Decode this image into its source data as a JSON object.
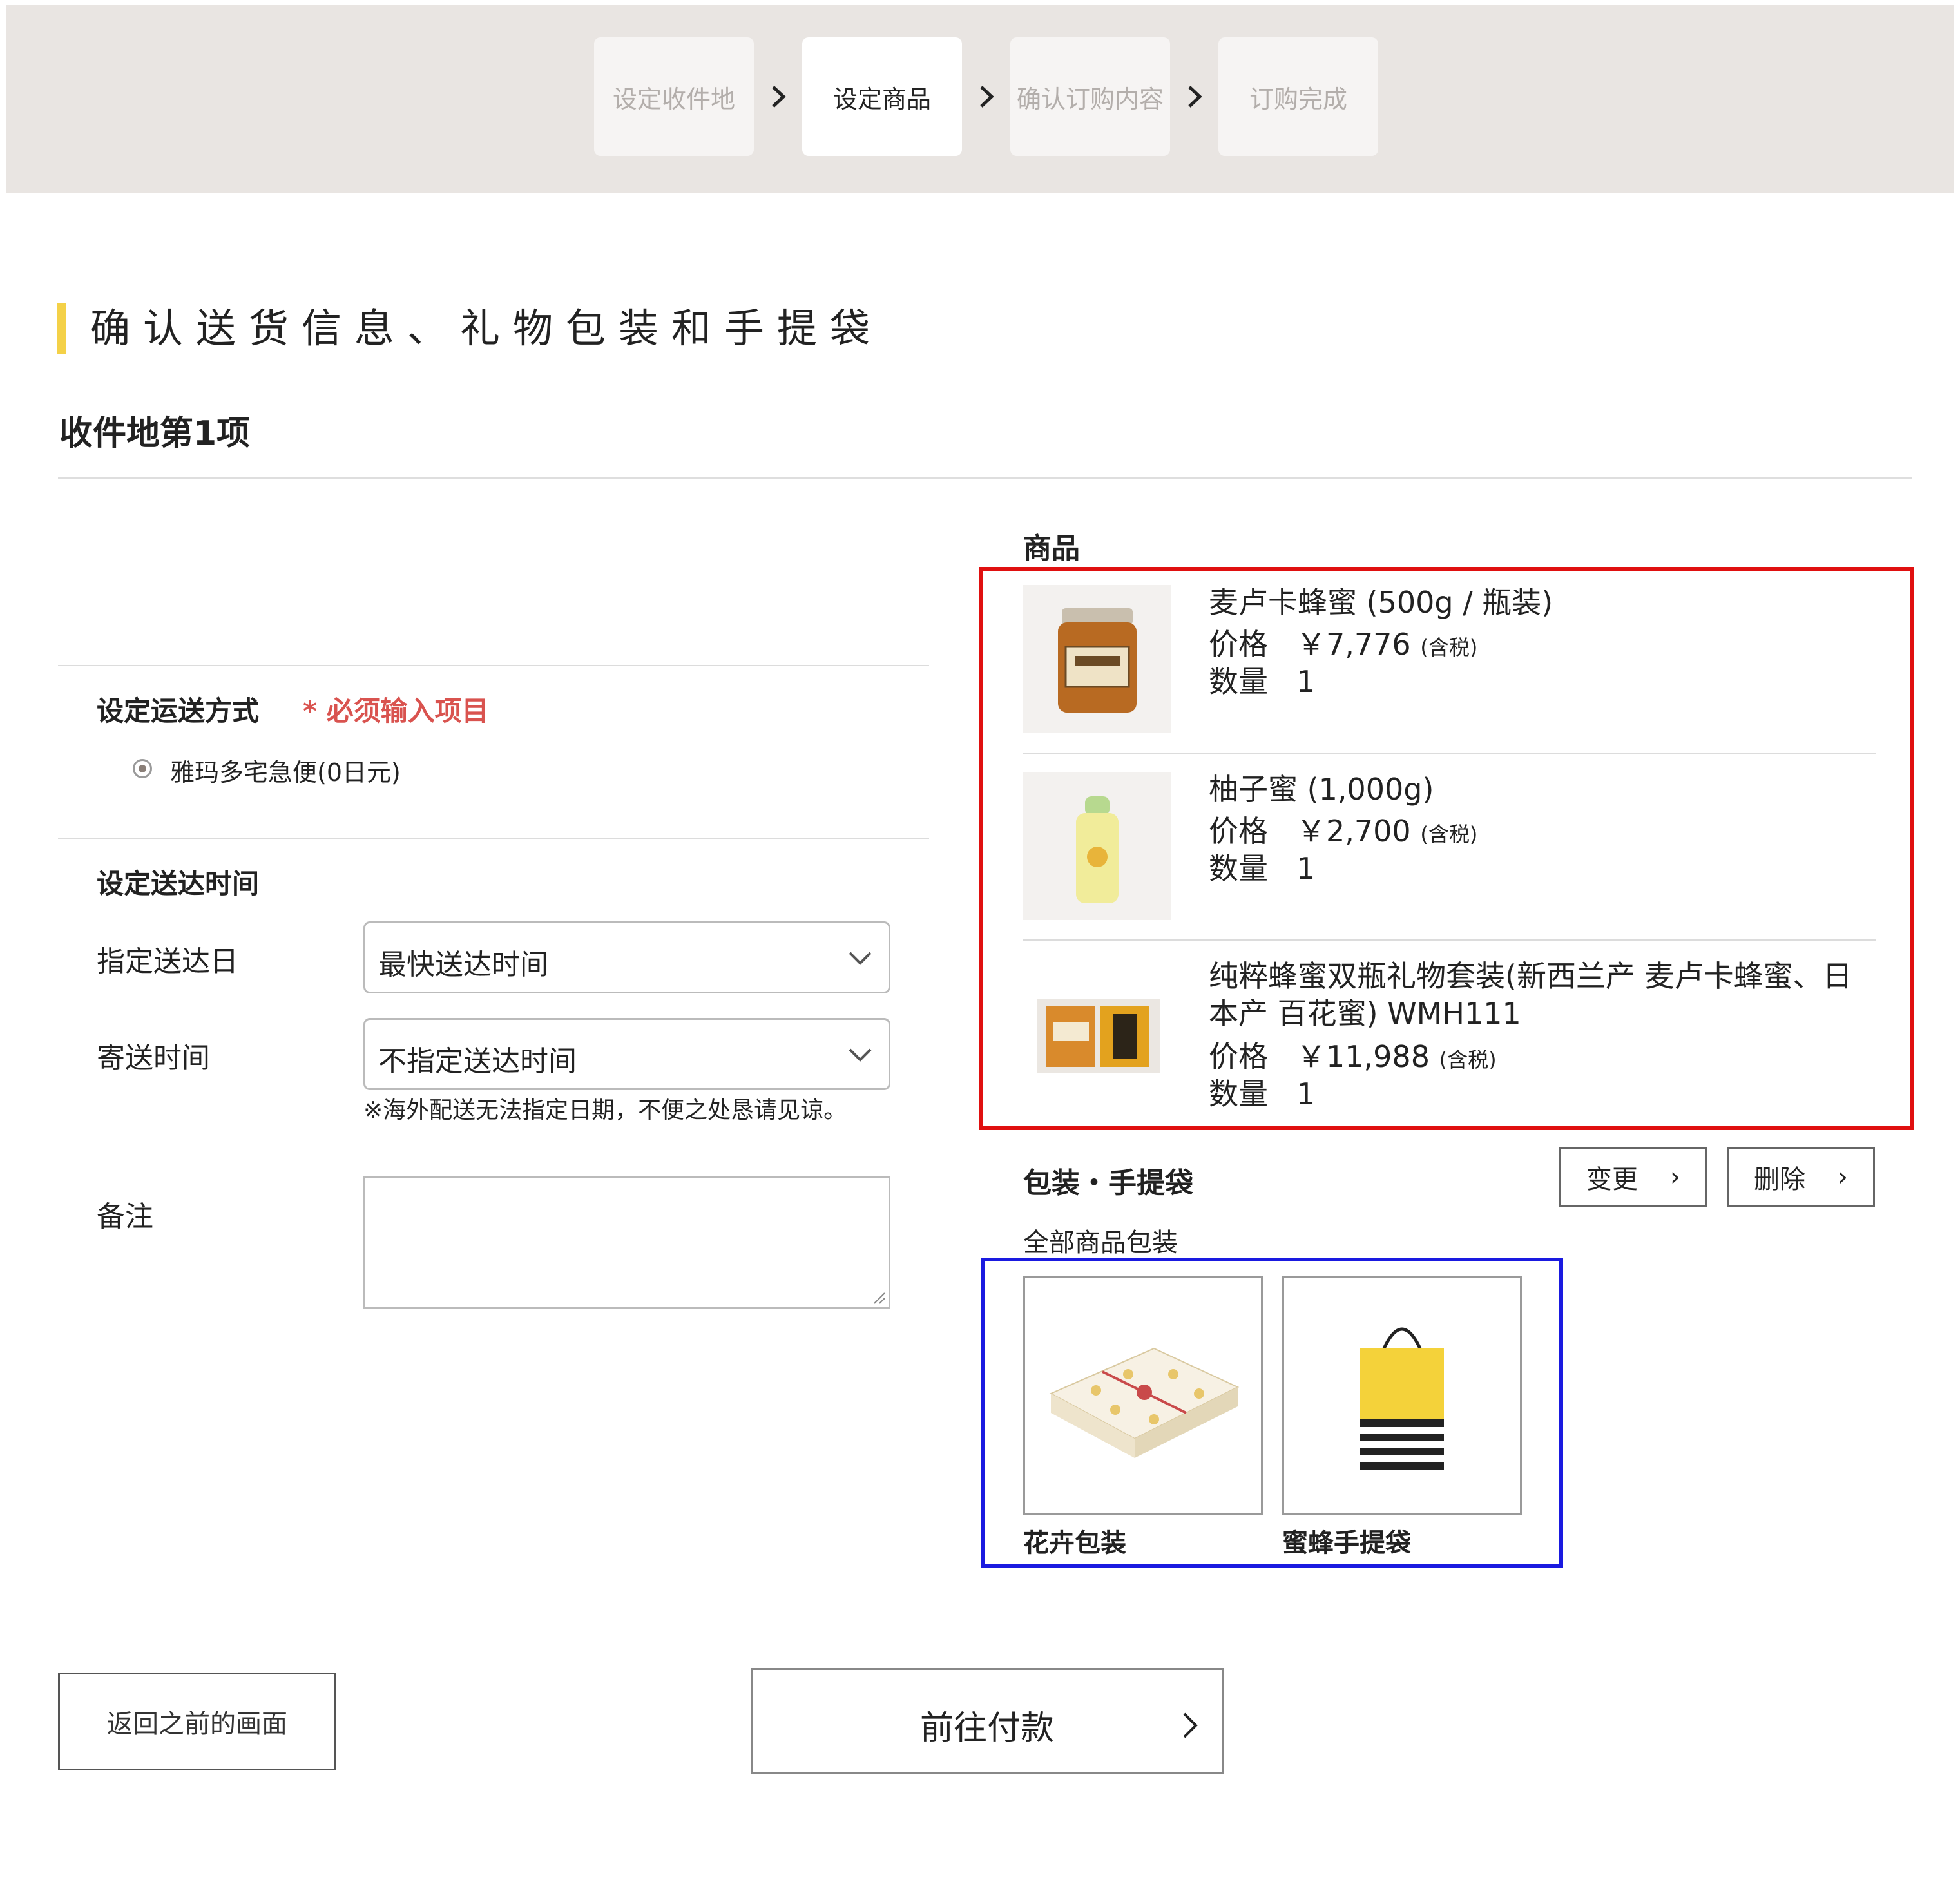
{
  "stepper": {
    "steps": [
      "设定收件地",
      "设定商品",
      "确认订购内容",
      "订购完成"
    ],
    "active_index": 1
  },
  "page_title": "确认送货信息、礼物包装和手提袋",
  "destination_title": "收件地第1项",
  "shipping": {
    "label": "设定运送方式",
    "required": "* 必须输入项目",
    "option": "雅玛多宅急便(0日元)"
  },
  "delivery_time": {
    "label": "设定送达时间",
    "date_label": "指定送达日",
    "date_value": "最快送达时间",
    "time_label": "寄送时间",
    "time_value": "不指定送达时间",
    "note": "※海外配送无法指定日期，不便之处恳请见谅。",
    "remarks_label": "备注"
  },
  "items": {
    "title": "商品",
    "price_label": "价格",
    "qty_label": "数量",
    "tax_label": "(含税)",
    "list": [
      {
        "name": "麦卢卡蜂蜜 (500g / 瓶装)",
        "price": "￥7,776",
        "qty": "1"
      },
      {
        "name": "柚子蜜 (1,000g)",
        "price": "￥2,700",
        "qty": "1"
      },
      {
        "name": "纯粹蜂蜜双瓶礼物套装(新西兰产 麦卢卡蜂蜜、日本产 百花蜜) WMH111",
        "price": "￥11,988",
        "qty": "1"
      }
    ]
  },
  "wrapping": {
    "title": "包装・手提袋",
    "change_label": "变更",
    "delete_label": "删除",
    "subtitle": "全部商品包装",
    "options": [
      {
        "label": "花卉包装"
      },
      {
        "label": "蜜蜂手提袋"
      }
    ]
  },
  "buttons": {
    "back": "返回之前的画面",
    "pay": "前往付款"
  },
  "colors": {
    "accent": "#f4d148",
    "required": "#d9534f",
    "stepper_bg": "#e9e5e2"
  }
}
